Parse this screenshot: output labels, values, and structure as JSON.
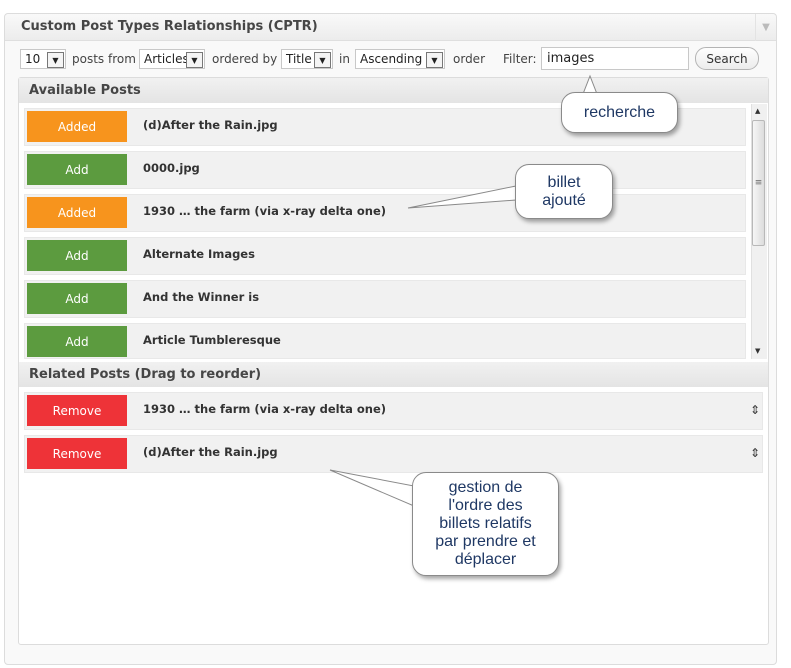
{
  "window": {
    "title": "Custom Post Types Relationships (CPTR)",
    "collapse_icon": "triangle-down"
  },
  "toolbar": {
    "count_value": "10",
    "posts_from_label": "posts from",
    "post_type_value": "Articles",
    "ordered_by_label": "ordered by",
    "order_field_value": "Title",
    "in_label": "in",
    "order_dir_value": "Ascending",
    "order_label": "order",
    "filter_label": "Filter:",
    "filter_value": "images",
    "search_label": "Search"
  },
  "available": {
    "header": "Available Posts",
    "items": [
      {
        "button": "Added",
        "status": "added",
        "title": "(d)After the Rain.jpg"
      },
      {
        "button": "Add",
        "status": "add",
        "title": "0000.jpg"
      },
      {
        "button": "Added",
        "status": "added",
        "title": "1930 … the farm (via x-ray delta one)"
      },
      {
        "button": "Add",
        "status": "add",
        "title": "Alternate Images"
      },
      {
        "button": "Add",
        "status": "add",
        "title": "And the Winner is"
      },
      {
        "button": "Add",
        "status": "add",
        "title": "Article Tumbleresque"
      }
    ]
  },
  "related": {
    "header": "Related Posts (Drag to reorder)",
    "items": [
      {
        "button": "Remove",
        "title": "1930 … the farm (via x-ray delta one)",
        "drag": "⇕"
      },
      {
        "button": "Remove",
        "title": "(d)After the Rain.jpg",
        "drag": "⇕"
      }
    ]
  },
  "callouts": {
    "search": "recherche",
    "added_line1": "billet",
    "added_line2": "ajouté",
    "order_line1": "gestion de",
    "order_line2": "l'ordre des",
    "order_line3": "billets relatifs",
    "order_line4": "par prendre et",
    "order_line5": "déplacer"
  },
  "colors": {
    "added": "#f7941d",
    "add": "#5c9b3f",
    "remove": "#ee3338"
  }
}
